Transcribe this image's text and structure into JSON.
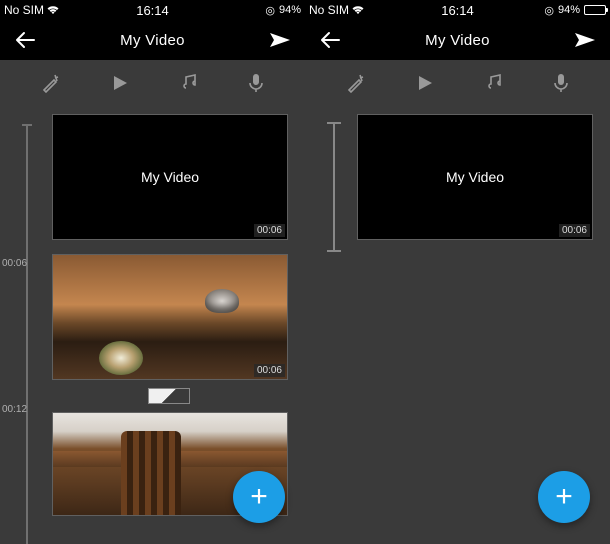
{
  "status": {
    "carrier": "No SIM",
    "time": "16:14",
    "battery_text_left": "94%",
    "battery_text_right": "94%"
  },
  "header": {
    "title": "My Video"
  },
  "clips": {
    "title_card_label": "My Video",
    "clip1_duration": "00:06",
    "clip2_duration": "00:06"
  },
  "timeline": {
    "t0": "00:06",
    "t1": "00:12"
  },
  "icons": {
    "circle_glyph": "◎"
  }
}
